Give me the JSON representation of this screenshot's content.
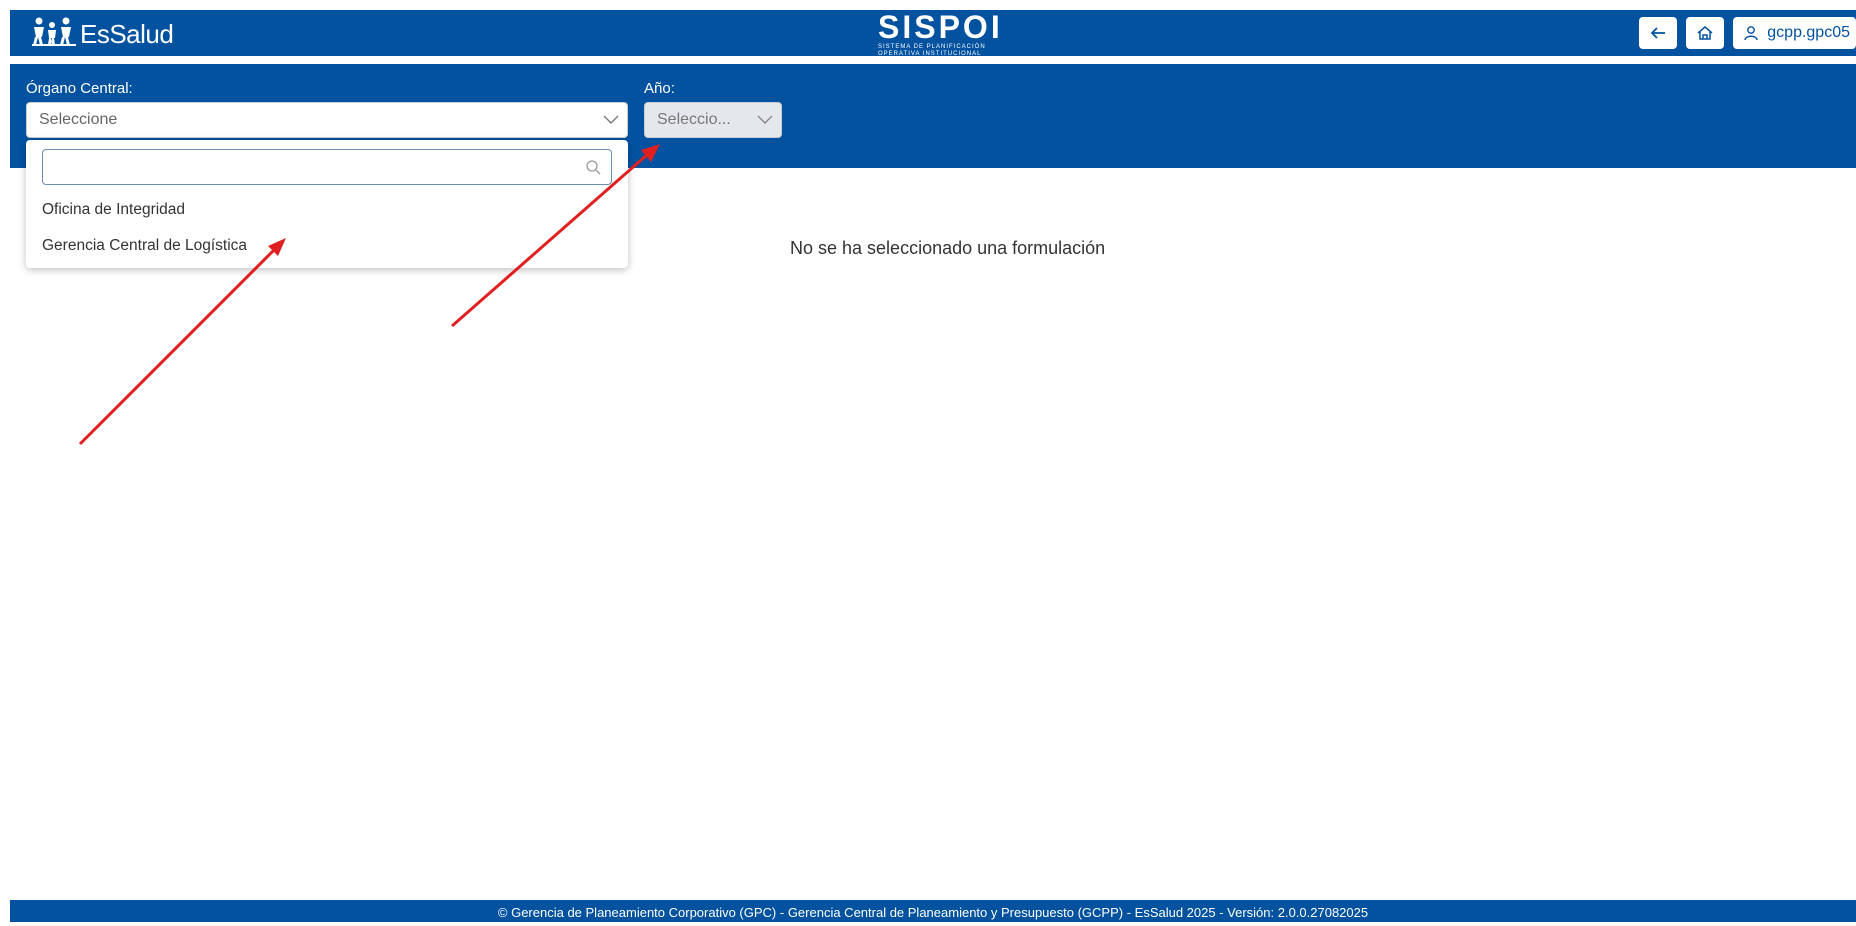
{
  "header": {
    "logo_text": "EsSalud",
    "brand_title": "SISPOI",
    "brand_subtitle_1": "SISTEMA DE PLANIFICACIÓN",
    "brand_subtitle_2": "OPERATIVA INSTITUCIONAL",
    "username": "gcpp.gpc05",
    "back_icon": "arrow-left-icon",
    "home_icon": "home-icon",
    "user_icon": "user-icon"
  },
  "filters": {
    "organo_label": "Órgano Central:",
    "organo_value": "Seleccione",
    "anio_label": "Año:",
    "anio_value": "Seleccio..."
  },
  "dropdown": {
    "search_value": "",
    "items": [
      "Oficina de Integridad",
      "Gerencia Central de Logística"
    ]
  },
  "main": {
    "empty_message": "No se ha seleccionado una formulación"
  },
  "footer": {
    "text": "© Gerencia de Planeamiento Corporativo (GPC) - Gerencia Central de Planeamiento y Presupuesto (GCPP) - EsSalud 2025 - Versión: 2.0.0.27082025"
  },
  "colors": {
    "primary": "#0252a0",
    "arrow": "#e02020"
  }
}
